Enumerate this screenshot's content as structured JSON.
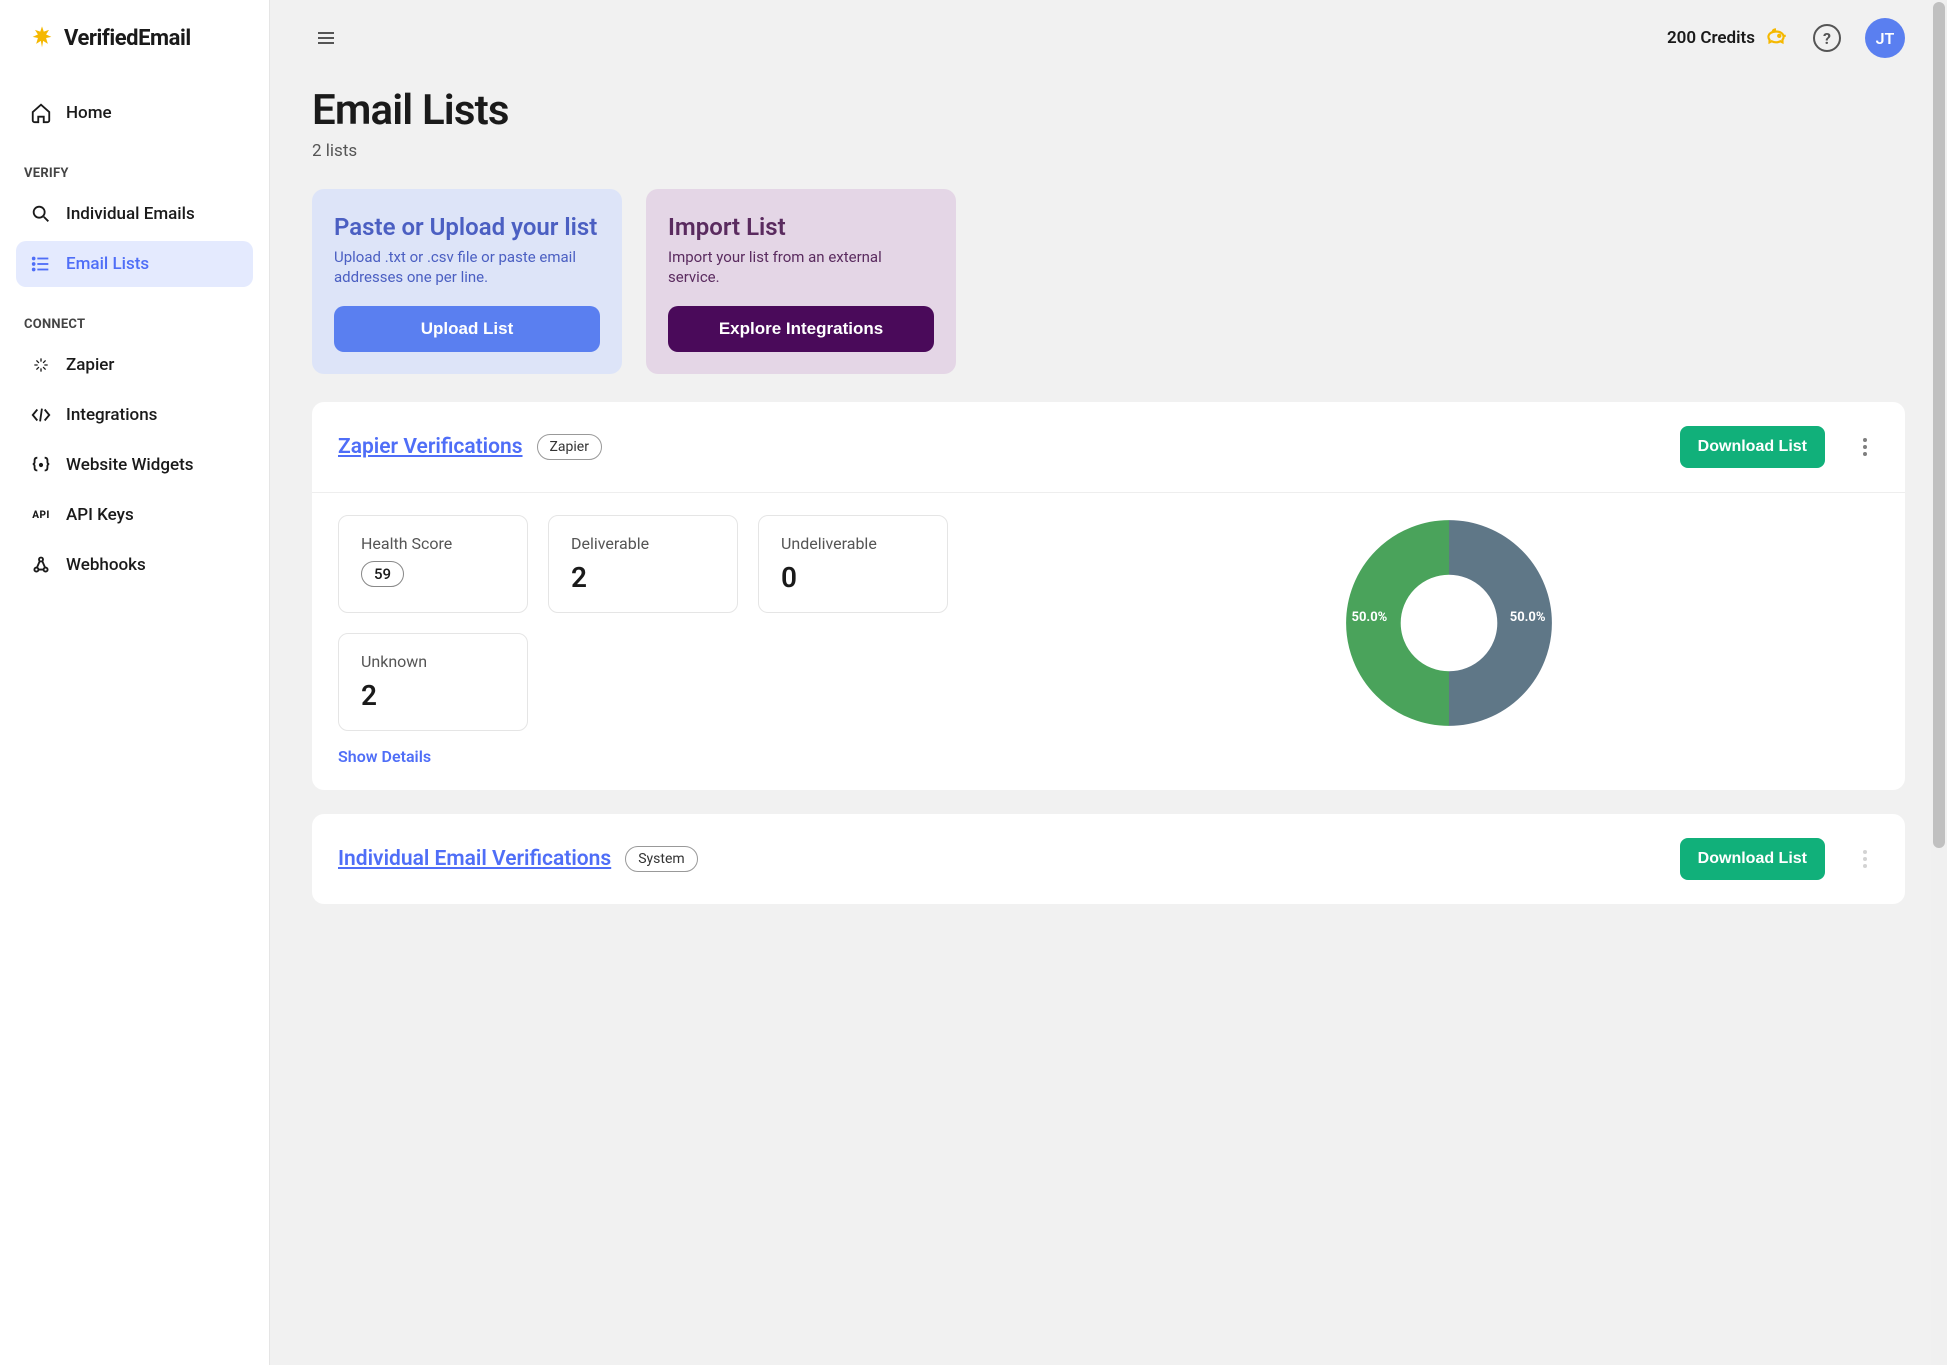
{
  "brand": "VerifiedEmail",
  "sidebar": {
    "home": "Home",
    "sections": {
      "verify_label": "VERIFY",
      "connect_label": "CONNECT"
    },
    "items": {
      "individual": "Individual Emails",
      "lists": "Email Lists",
      "zapier": "Zapier",
      "integrations": "Integrations",
      "widgets": "Website Widgets",
      "api": "API Keys",
      "webhooks": "Webhooks"
    }
  },
  "header": {
    "credits": "200 Credits",
    "avatar": "JT"
  },
  "page": {
    "title": "Email Lists",
    "subtitle": "2 lists"
  },
  "upload_card": {
    "title": "Paste or Upload your list",
    "desc": "Upload .txt or .csv file or paste email addresses one per line.",
    "button": "Upload List"
  },
  "import_card": {
    "title": "Import List",
    "desc": "Import your list from an external service.",
    "button": "Explore Integrations"
  },
  "lists": [
    {
      "name": "Zapier Verifications",
      "tag": "Zapier",
      "download": "Download List",
      "stats": {
        "health_label": "Health Score",
        "health_value": "59",
        "deliverable_label": "Deliverable",
        "deliverable_value": "2",
        "undeliverable_label": "Undeliverable",
        "undeliverable_value": "0",
        "unknown_label": "Unknown",
        "unknown_value": "2"
      },
      "show_details": "Show Details"
    },
    {
      "name": "Individual Email Verifications",
      "tag": "System",
      "download": "Download List"
    }
  ],
  "chart_data": {
    "type": "pie",
    "series": [
      {
        "name": "Deliverable",
        "value": 50.0,
        "label": "50.0%",
        "color": "#4aa35b"
      },
      {
        "name": "Unknown",
        "value": 50.0,
        "label": "50.0%",
        "color": "#5f7787"
      }
    ]
  }
}
